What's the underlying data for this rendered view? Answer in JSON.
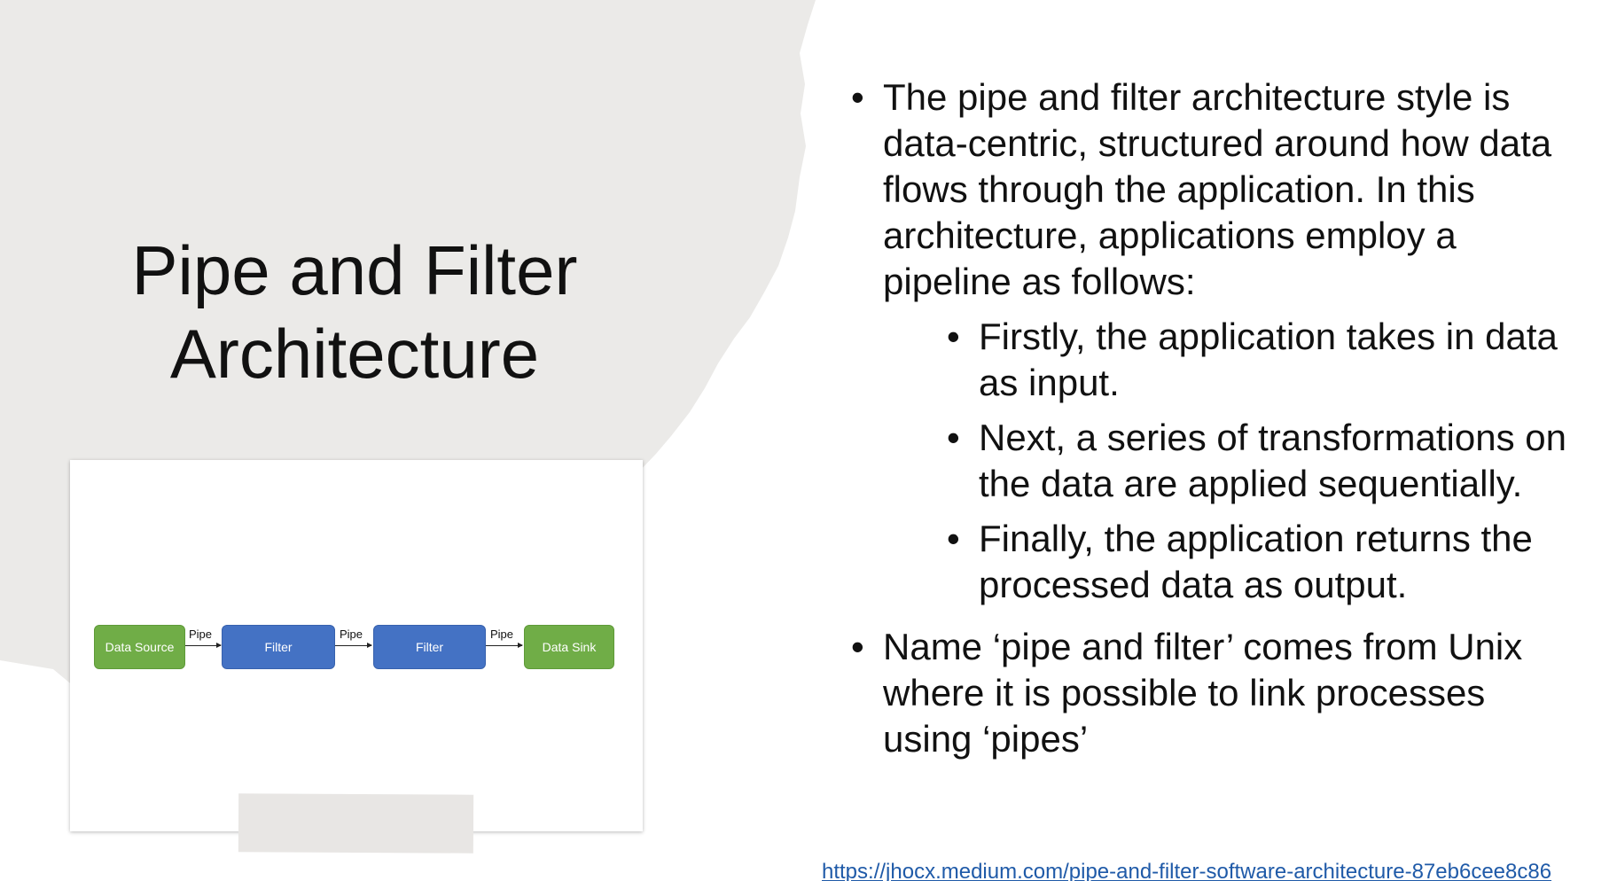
{
  "slide": {
    "title_lines": [
      "Pipe and Filter",
      "Architecture"
    ],
    "bullets": [
      {
        "text": "The pipe and filter architecture style is data-centric, structured around how data flows through the application. In this architecture, applications employ a pipeline as follows:"
      },
      {
        "text": "Name ‘pipe and filter’ comes from Unix where it is possible to link processes using ‘pipes’"
      }
    ],
    "sub_bullets": [
      "Firstly, the application takes in data as input.",
      "Next, a series of transformations on the data are applied sequentially.",
      "Finally, the application returns the processed data as output."
    ],
    "bullet_glyph": "•",
    "source_link": "https://jhocx.medium.com/pipe-and-filter-software-architecture-87eb6cee8c86"
  },
  "diagram": {
    "nodes": [
      "Data Source",
      "Filter",
      "Filter",
      "Data Sink"
    ],
    "node_colors": [
      "#70ad47",
      "#4472c4",
      "#4472c4",
      "#70ad47"
    ],
    "pipe_label": "Pipe"
  },
  "colors": {
    "torn_background": "#ebeae8",
    "link": "#1f5aa8",
    "source_sink": "#70ad47",
    "filter": "#4472c4"
  }
}
